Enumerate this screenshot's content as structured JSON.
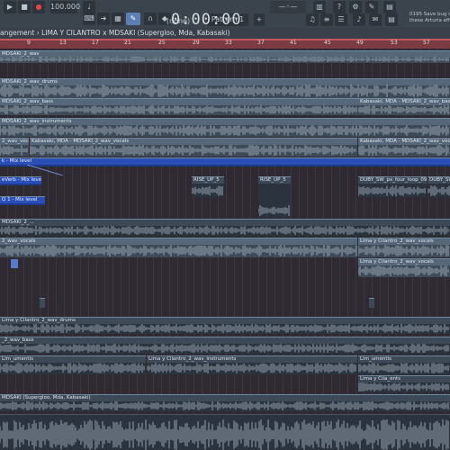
{
  "toolbar": {
    "time": "0:00:00",
    "tempo": "100.000",
    "snap_value": "(none)",
    "pattern": "Pattern 1",
    "hint_line1": "0195 Save bug re",
    "hint_line2": "these Arturia effe"
  },
  "title_bar": {
    "text": "angement › LIMA Y CILANTRO x MDSAKI (Supergloo, Mda, Kabasaki)"
  },
  "ruler": {
    "bars": [
      "9",
      "13",
      "17",
      "21",
      "25",
      "29",
      "33",
      "37",
      "41",
      "45",
      "49",
      "53",
      "57"
    ]
  },
  "clips": {
    "c1": "MDSAKI_2_wav",
    "c2": "MDSAKI_2_wav_drums",
    "c3": "MDSAKI_2_wav_bass",
    "c4": "Kabasaki, MDA - MDSAKI_2_wav_bass",
    "c5": "MDSAKI_2_wav_instruments",
    "c6": "2_wav_vocals",
    "c7": "Kabasaki, MDA - MDSAKI_2_wav_vocals",
    "c8": "Kabasaki, MDA - MDSAKI_2_wav_vocals",
    "c9": "k - Mix level",
    "c10": "eVerb - Mix level",
    "c11": "Q 1 - Mix level",
    "c12": "RISE_UP_5",
    "c13": "RISE_UP_5",
    "c14": "DUBY_SW_px_four_loop_09",
    "c15": "DUBY_SW",
    "c16": "MDSAKI_2_...",
    "c17": "2_wav_vocals",
    "c18": "Lima y Cilantro_2_wav_vocals",
    "c19": "Lima y Cilantro_2_wav_vocals",
    "c20": "Lima y Cilantro_2_wav_drums",
    "c21": "_2_wav_bass",
    "c22": "Lim_umentis",
    "c23": "Lima y Cilantro_2_wav_instruments",
    "c24": "Lim_umentis",
    "c25": "Lima y Cila_ents",
    "c26": "MDSAKI (Supergloo, Mda, Kabasaki)"
  },
  "colors": {
    "toolbar_bg": "#3b434c",
    "ruler_bg": "#7a3c42",
    "playlist_bg": "#2f2a31",
    "clip_header": "#566779",
    "automation": "#1d3a8a",
    "waveform": "#aebdca"
  }
}
